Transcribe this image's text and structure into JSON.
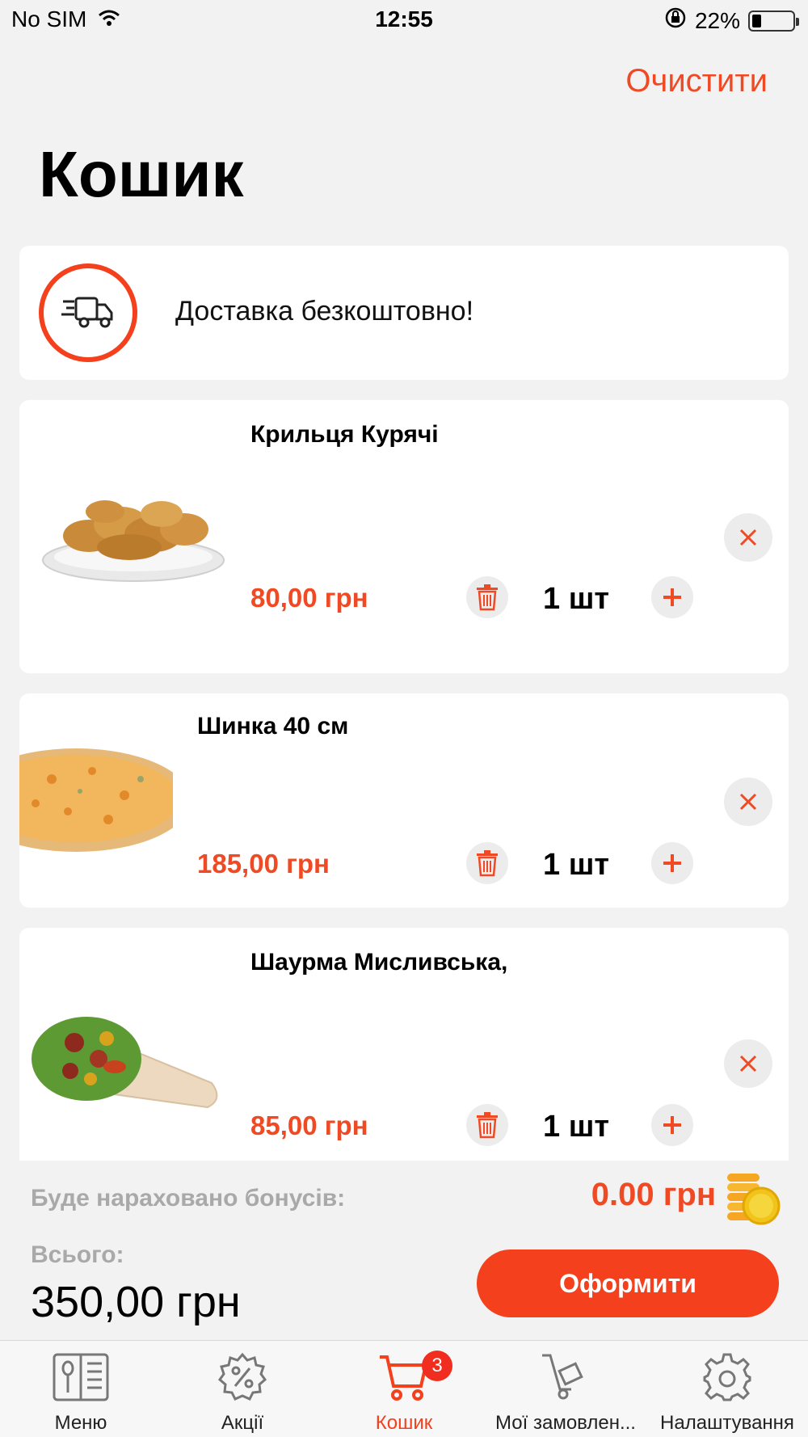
{
  "status_bar": {
    "carrier": "No SIM",
    "time": "12:55",
    "battery_percent": "22%",
    "battery_level": 0.22
  },
  "header": {
    "clear_label": "Очистити",
    "title": "Кошик"
  },
  "delivery": {
    "icon": "delivery-truck-icon",
    "text": "Доставка безкоштовно!"
  },
  "cart_items": [
    {
      "name": "Крильця Курячі",
      "price": "80,00 грн",
      "quantity": "1 шт",
      "image": "chicken-wings"
    },
    {
      "name": "Шинка 40 см",
      "price": "185,00 грн",
      "quantity": "1 шт",
      "image": "pizza"
    },
    {
      "name": "Шаурма Мисливська,",
      "price": "85,00 грн",
      "quantity": "1 шт",
      "image": "shawarma"
    }
  ],
  "summary": {
    "bonus_label": "Буде нараховано бонусів:",
    "bonus_value": "0.00 грн",
    "total_label": "Всього:",
    "total_value": "350,00 грн",
    "checkout_label": "Оформити"
  },
  "tab_bar": {
    "tabs": [
      {
        "label": "Меню",
        "icon": "menu-book-icon"
      },
      {
        "label": "Акції",
        "icon": "discount-icon"
      },
      {
        "label": "Кошик",
        "icon": "cart-icon",
        "badge": "3",
        "active": true
      },
      {
        "label": "Мої замовлен...",
        "icon": "orders-cart-icon"
      },
      {
        "label": "Налаштування",
        "icon": "gear-icon"
      }
    ]
  },
  "colors": {
    "accent": "#f4401c",
    "price": "#f04a24",
    "background": "#f2f2f2"
  }
}
